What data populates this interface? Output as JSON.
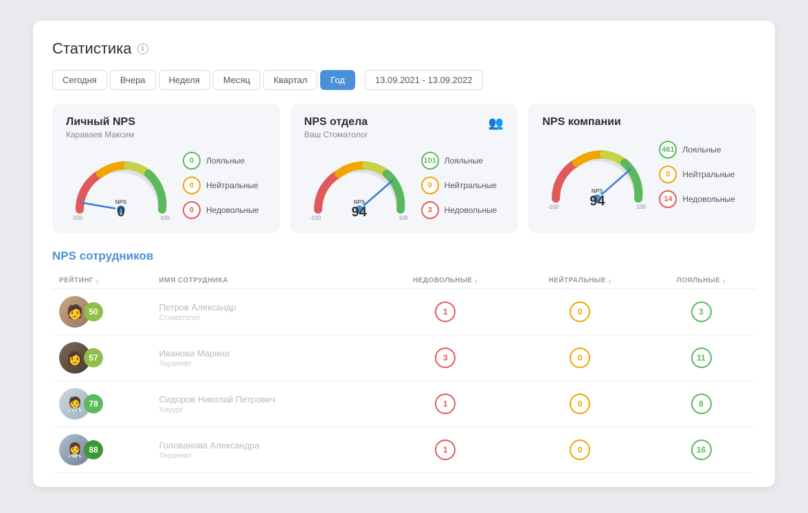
{
  "page": {
    "title": "Статистика",
    "info_icon": "ℹ"
  },
  "tabs": {
    "items": [
      "Сегодня",
      "Вчера",
      "Неделя",
      "Месяц",
      "Квартал",
      "Год"
    ],
    "active": "Год",
    "date_range": "13.09.2021 - 13.09.2022"
  },
  "nps_cards": [
    {
      "title": "Личный NPS",
      "subtitle": "Караваев Максим",
      "score": "0",
      "loyal": "0",
      "neutral": "0",
      "disloyal": "0",
      "needle_angle": -90,
      "show_team_icon": false
    },
    {
      "title": "NPS отдела",
      "subtitle": "Ваш Стоматолог",
      "score": "94",
      "loyal": "101",
      "neutral": "0",
      "disloyal": "3",
      "needle_angle": 60,
      "show_team_icon": true
    },
    {
      "title": "NPS компании",
      "subtitle": "",
      "score": "94",
      "loyal": "461",
      "neutral": "0",
      "disloyal": "14",
      "needle_angle": 60,
      "show_team_icon": false
    }
  ],
  "legend_labels": {
    "loyal": "Лояльные",
    "neutral": "Нейтральные",
    "disloyal": "Недовольные"
  },
  "employees": {
    "title": "NPS сотрудников",
    "columns": {
      "rating": "РЕЙТИНГ",
      "name": "ИМЯ СОТРУДНИКА",
      "disloyal": "НЕДОВОЛЬНЫЕ",
      "neutral": "НЕЙТРАЛЬНЫЕ",
      "loyal": "ЛОЯЛЬНЫЕ"
    },
    "rows": [
      {
        "rating": "50",
        "rating_color": "light-green",
        "avatar_type": "photo1",
        "name_line1": "Петров Александр",
        "name_line2": "Стоматолог",
        "disloyal": "1",
        "neutral": "0",
        "loyal": "3"
      },
      {
        "rating": "57",
        "rating_color": "light-green",
        "avatar_type": "photo2",
        "name_line1": "Иванова Марина",
        "name_line2": "Терапевт",
        "disloyal": "3",
        "neutral": "0",
        "loyal": "11"
      },
      {
        "rating": "78",
        "rating_color": "green",
        "avatar_type": "photo3",
        "name_line1": "Сидоров Николай Петрович",
        "name_line2": "Хирург",
        "disloyal": "1",
        "neutral": "0",
        "loyal": "8"
      },
      {
        "rating": "88",
        "rating_color": "dark-green",
        "avatar_type": "photo4",
        "name_line1": "Голованова Александра",
        "name_line2": "Терапевт",
        "disloyal": "1",
        "neutral": "0",
        "loyal": "16"
      }
    ]
  }
}
